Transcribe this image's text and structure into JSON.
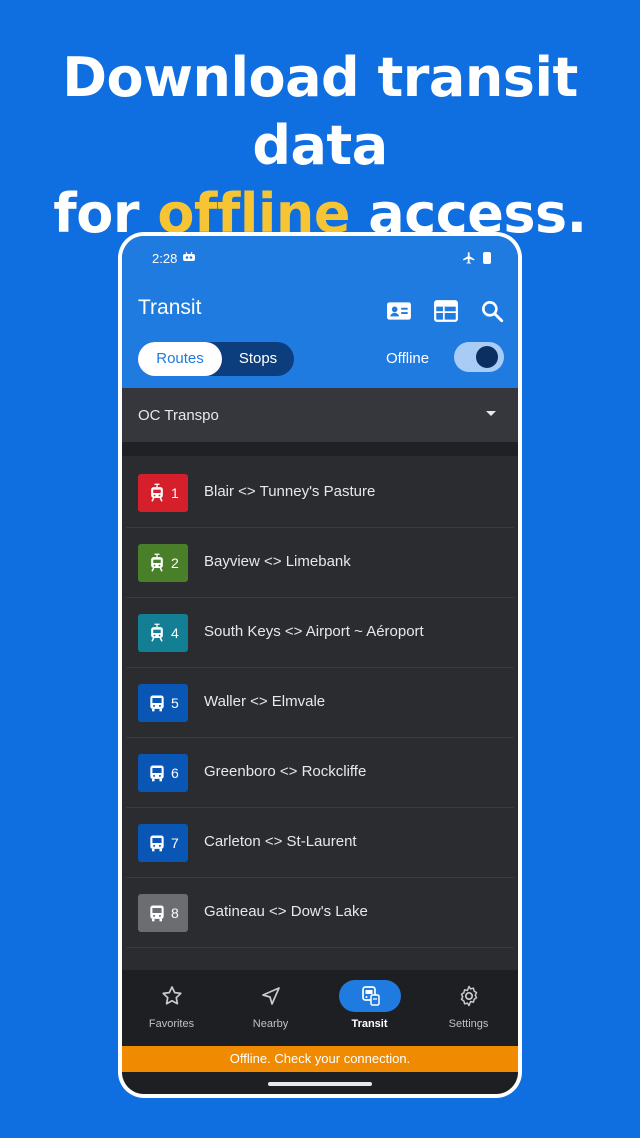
{
  "headline": {
    "line1": "Download transit data",
    "line2_before": "for ",
    "line2_accent": "offline",
    "line2_after": " access."
  },
  "colors": {
    "background": "#0f6ee0",
    "accent": "#f7c533",
    "app_bar": "#1f7be0",
    "offline_banner": "#f08a00"
  },
  "status_bar": {
    "time": "2:28",
    "icons": [
      "app-notification-icon",
      "airplane-mode-icon",
      "battery-icon"
    ]
  },
  "app_bar": {
    "title": "Transit",
    "actions": [
      "id-card-icon",
      "calendar-icon",
      "search-icon"
    ],
    "tabs": [
      "Routes",
      "Stops"
    ],
    "selected_tab": "Routes",
    "offline_label": "Offline",
    "offline_enabled": true
  },
  "agency": {
    "selected": "OC Transpo"
  },
  "routes": [
    {
      "number": "1",
      "name": "Blair <> Tunney's Pasture",
      "mode": "tram",
      "color": "#d5202b"
    },
    {
      "number": "2",
      "name": "Bayview <> Limebank",
      "mode": "tram",
      "color": "#4a7f2a"
    },
    {
      "number": "4",
      "name": "South Keys <> Airport ~ Aéroport",
      "mode": "tram",
      "color": "#137f95"
    },
    {
      "number": "5",
      "name": "Waller <> Elmvale",
      "mode": "bus",
      "color": "#0a56b5"
    },
    {
      "number": "6",
      "name": "Greenboro <> Rockcliffe",
      "mode": "bus",
      "color": "#0a56b5"
    },
    {
      "number": "7",
      "name": "Carleton <> St-Laurent",
      "mode": "bus",
      "color": "#0a56b5"
    },
    {
      "number": "8",
      "name": "Gatineau <> Dow's Lake",
      "mode": "bus",
      "color": "#6c6d70"
    }
  ],
  "bottom_nav": [
    {
      "label": "Favorites",
      "icon": "star-icon",
      "active": false
    },
    {
      "label": "Nearby",
      "icon": "navigation-arrow-icon",
      "active": false
    },
    {
      "label": "Transit",
      "icon": "transit-icon",
      "active": true
    },
    {
      "label": "Settings",
      "icon": "gear-icon",
      "active": false
    }
  ],
  "offline_banner": "Offline. Check your connection."
}
